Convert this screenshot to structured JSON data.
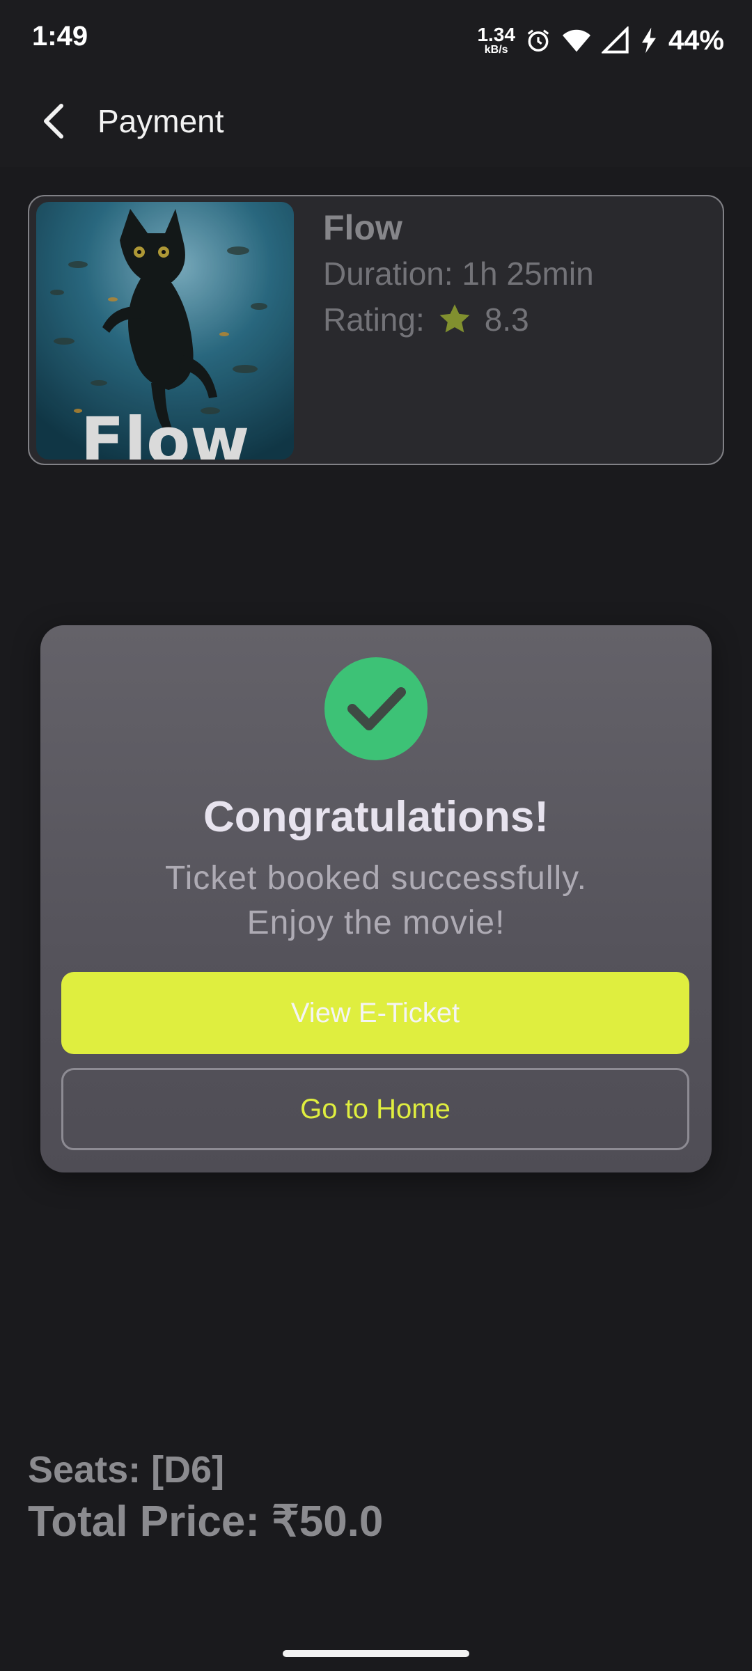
{
  "status_bar": {
    "time": "1:49",
    "net_speed_value": "1.34",
    "net_speed_unit": "kB/s",
    "battery_percent": "44%"
  },
  "app_bar": {
    "title": "Payment",
    "back_icon": "chevron-left-icon"
  },
  "movie": {
    "title": "Flow",
    "duration": "Duration: 1h 25min",
    "rating_label": "Rating:",
    "rating_value": "8.3",
    "poster_text": "Flow"
  },
  "dialog": {
    "title": "Congratulations!",
    "message_line1": "Ticket booked successfully.",
    "message_line2": "Enjoy the movie!",
    "primary_button": "View E-Ticket",
    "secondary_button": "Go to Home"
  },
  "summary": {
    "seats": "Seats: [D6]",
    "total_price": "Total Price: ₹50.0"
  },
  "colors": {
    "accent": "#dfee3f",
    "success": "#3dc276",
    "star": "#8a9a32",
    "background": "#1c1c1f"
  }
}
